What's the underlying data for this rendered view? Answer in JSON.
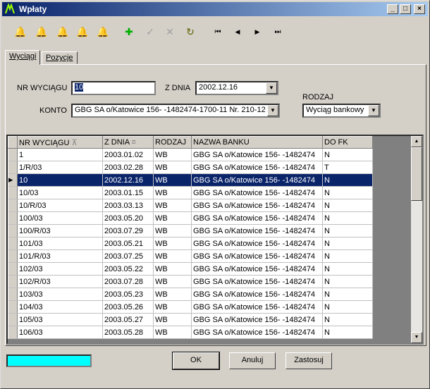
{
  "window": {
    "title": "Wpłaty",
    "controls": {
      "minimize": "_",
      "maximize": "□",
      "close": "×"
    }
  },
  "toolbar": {
    "icons": [
      "bell-icon",
      "edit-bell-icon",
      "cut-bell-icon",
      "print-bell-icon",
      "color-bell-icon",
      "add-icon",
      "check-icon",
      "cancel-icon",
      "refresh-icon",
      "first-icon",
      "prev-icon",
      "next-icon",
      "last-icon"
    ],
    "glyphs": {
      "bell": "🔔",
      "add": "✚",
      "check": "✓",
      "cancel": "✕",
      "refresh": "↻",
      "first": "⏮",
      "prev": "◀",
      "next": "▶",
      "last": "⏭"
    }
  },
  "tabs": [
    {
      "label": "Wyciągi",
      "active": true
    },
    {
      "label": "Pozycje",
      "active": false
    }
  ],
  "form": {
    "nr_label": "NR WYCIĄGU",
    "nr_value": "10",
    "zdnia_label": "Z DNIA",
    "zdnia_value": "2002.12.16",
    "konto_label": "KONTO",
    "konto_value": "GBG SA o/Katowice  156-   -1482474-1700-11  Nr. 210-12",
    "rodzaj_label": "RODZAJ",
    "rodzaj_value": "Wyciąg bankowy"
  },
  "grid": {
    "columns": [
      "NR WYCIĄGU",
      "Z DNIA",
      "RODZAJ",
      "NAZWA BANKU",
      "DO FK"
    ],
    "rows": [
      [
        "1",
        "2003.01.02",
        "WB",
        "GBG SA o/Katowice  156-   -1482474",
        "N"
      ],
      [
        "1/R/03",
        "2003.02.28",
        "WB",
        "GBG SA o/Katowice  156-   -1482474",
        "T"
      ],
      [
        "10",
        "2002.12.16",
        "WB",
        "GBG SA o/Katowice  156-   -1482474",
        "N"
      ],
      [
        "10/03",
        "2003.01.15",
        "WB",
        "GBG SA o/Katowice  156-   -1482474",
        "N"
      ],
      [
        "10/R/03",
        "2003.03.13",
        "WB",
        "GBG SA o/Katowice  156-   -1482474",
        "N"
      ],
      [
        "100/03",
        "2003.05.20",
        "WB",
        "GBG SA o/Katowice  156-   -1482474",
        "N"
      ],
      [
        "100/R/03",
        "2003.07.29",
        "WB",
        "GBG SA o/Katowice  156-   -1482474",
        "N"
      ],
      [
        "101/03",
        "2003.05.21",
        "WB",
        "GBG SA o/Katowice  156-   -1482474",
        "N"
      ],
      [
        "101/R/03",
        "2003.07.25",
        "WB",
        "GBG SA o/Katowice  156-   -1482474",
        "N"
      ],
      [
        "102/03",
        "2003.05.22",
        "WB",
        "GBG SA o/Katowice  156-   -1482474",
        "N"
      ],
      [
        "102/R/03",
        "2003.07.28",
        "WB",
        "GBG SA o/Katowice  156-   -1482474",
        "N"
      ],
      [
        "103/03",
        "2003.05.23",
        "WB",
        "GBG SA o/Katowice  156-   -1482474",
        "N"
      ],
      [
        "104/03",
        "2003.05.26",
        "WB",
        "GBG SA o/Katowice  156-   -1482474",
        "N"
      ],
      [
        "105/03",
        "2003.05.27",
        "WB",
        "GBG SA o/Katowice  156-   -1482474",
        "N"
      ],
      [
        "106/03",
        "2003.05.28",
        "WB",
        "GBG SA o/Katowice  156-   -1482474",
        "N"
      ]
    ],
    "selected_row": 2
  },
  "buttons": {
    "ok": "OK",
    "cancel": "Anuluj",
    "apply": "Zastosuj"
  },
  "colors": {
    "selection": "#0a246a",
    "status": "#00ffff",
    "titlebar": "#0a246a"
  }
}
